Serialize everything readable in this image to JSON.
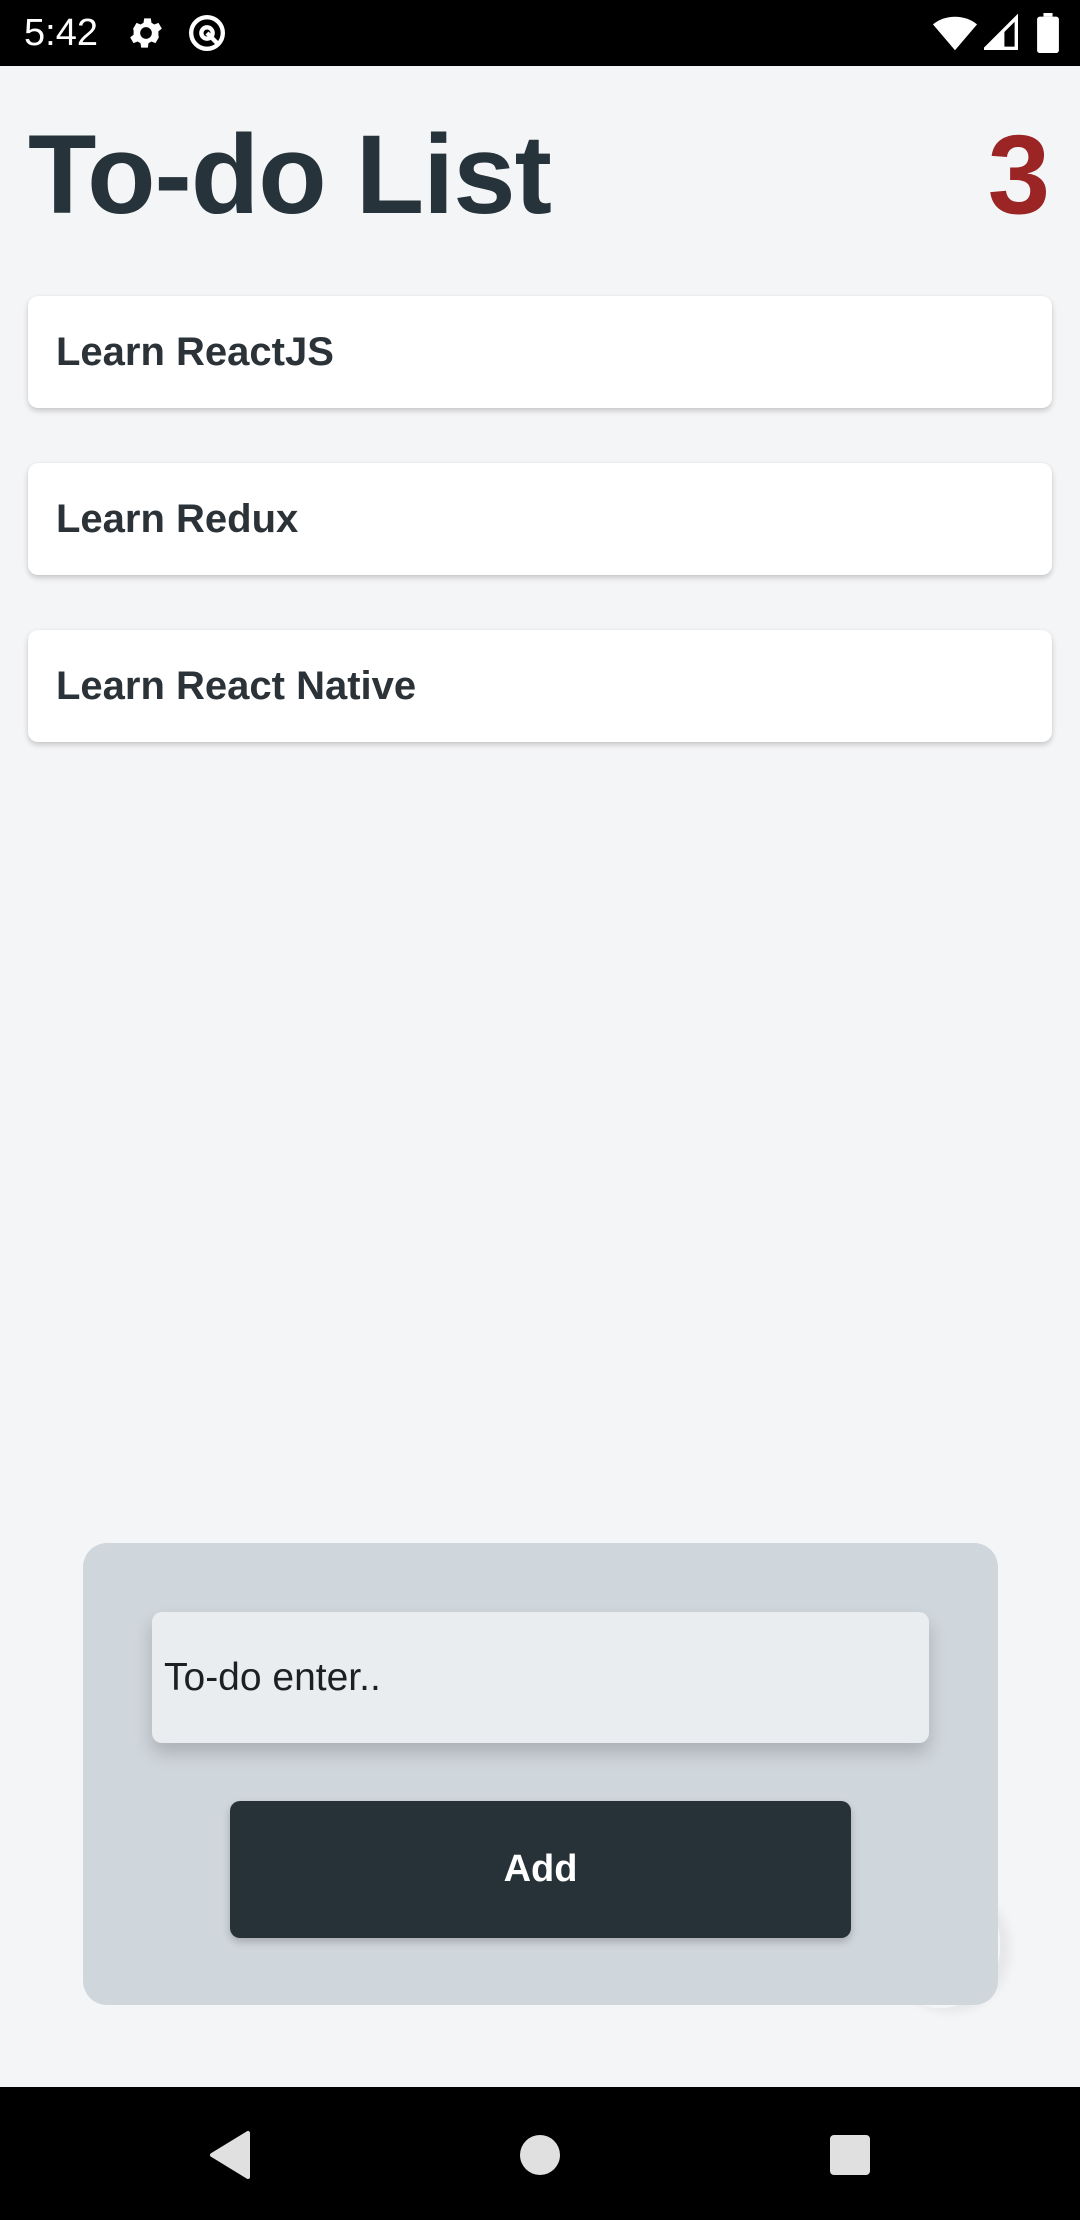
{
  "status_bar": {
    "time": "5:42",
    "icons": [
      "gear-icon",
      "at-sign-icon",
      "wifi-icon",
      "signal-icon",
      "battery-icon"
    ]
  },
  "header": {
    "title": "To-do List",
    "count": "3"
  },
  "todos": [
    {
      "label": "Learn ReactJS"
    },
    {
      "label": "Learn Redux"
    },
    {
      "label": "Learn React Native"
    }
  ],
  "form": {
    "input_placeholder": "To-do enter..",
    "input_value": "",
    "add_label": "Add"
  },
  "nav_bar": {
    "icons": [
      "back-icon",
      "home-icon",
      "recents-icon"
    ]
  },
  "colors": {
    "title": "#26333a",
    "count": "#9b2425",
    "panel": "#cfd6dc",
    "button": "#263238",
    "background": "#f4f5f7"
  }
}
